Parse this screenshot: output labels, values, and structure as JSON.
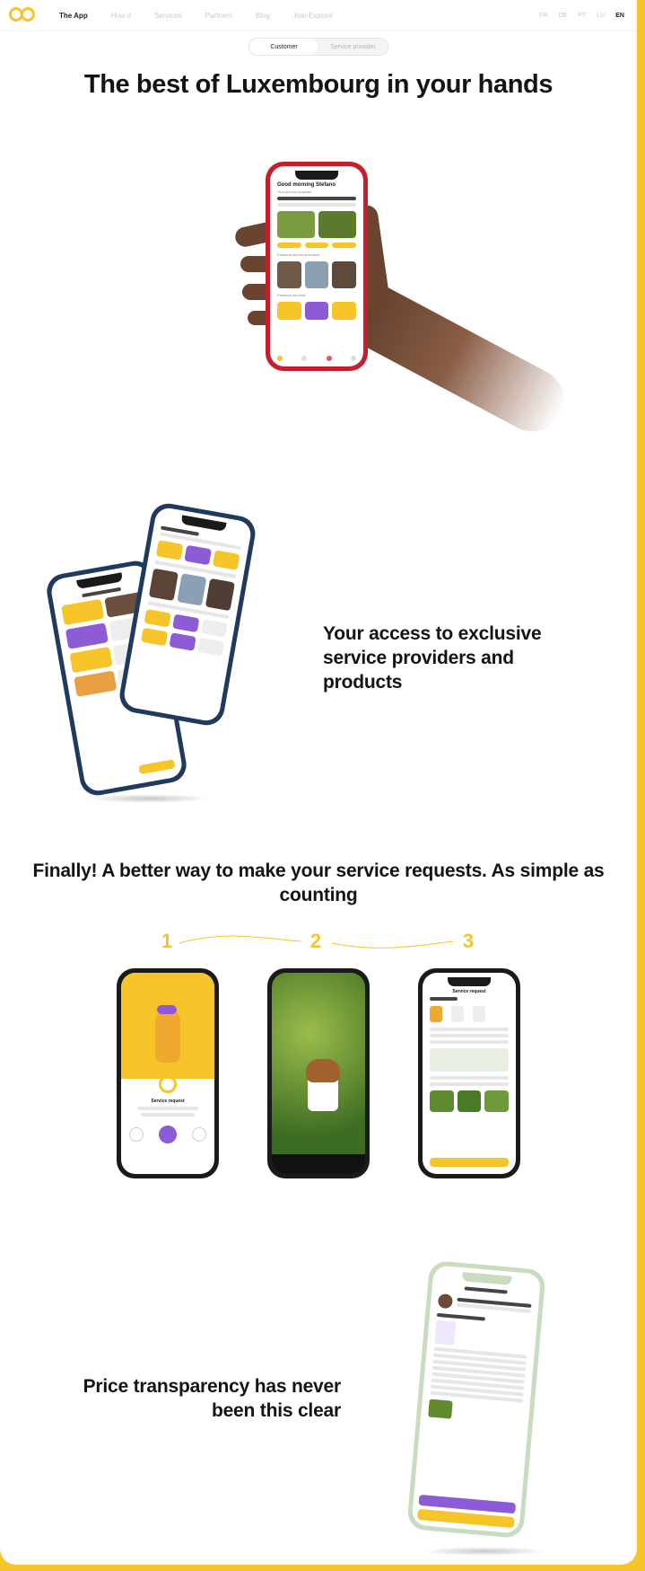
{
  "nav": {
    "logo": "logo-icon",
    "links": [
      "The App",
      "How it",
      "Services",
      "Partners",
      "Blog",
      "Join Explore"
    ],
    "languages": [
      "FR",
      "DE",
      "PT",
      "LU",
      "EN"
    ]
  },
  "toggle": {
    "customer": "Customer",
    "provider": "Service provider"
  },
  "hero": {
    "title": "The best of Luxembourg in your hands"
  },
  "phone1": {
    "greeting": "Good morning Stefano",
    "section_a": "Your service requests",
    "section_b": "Featured service providers",
    "section_c": "Featured services"
  },
  "section2": {
    "title": "Your access to exclusive service providers and products"
  },
  "section3": {
    "title": "Finally! A better way to make your service requests. As simple as counting",
    "steps": [
      "1",
      "2",
      "3"
    ],
    "step1_caption": "Service request",
    "step3_title": "Service request"
  },
  "section4": {
    "title": "Price transparency has never been this clear"
  },
  "colors": {
    "accent": "#f5c52a",
    "purple": "#8e5bd6",
    "dark": "#1a1a1a"
  }
}
